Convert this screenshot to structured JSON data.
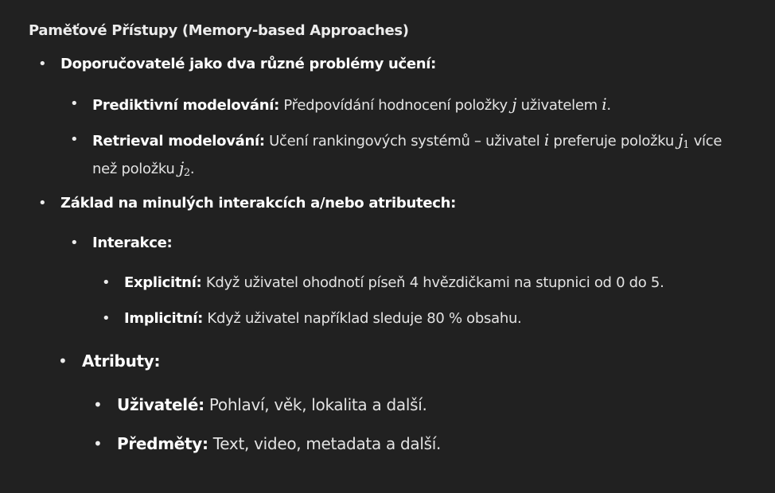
{
  "title": "Paměťové Přístupy (Memory-based Approaches)",
  "sections": {
    "recommenders": {
      "label": "Doporučovatelé jako dva různé problémy učení:",
      "predictive": {
        "label": "Prediktivní modelování:",
        "text_a": " Předpovídání hodnocení položky ",
        "var_j": "j",
        "text_b": " uživatelem ",
        "var_i": "i",
        "text_c": "."
      },
      "retrieval": {
        "label": "Retrieval modelování:",
        "text_a": " Učení rankingových systémů – uživatel ",
        "var_i": "i",
        "text_b": " preferuje položku ",
        "var_j": "j",
        "sub_1": "1",
        "text_c": " více",
        "line2_a": "než položku ",
        "var_j2": "j",
        "sub_2": "2",
        "line2_b": "."
      }
    },
    "basis": {
      "label": "Základ na minulých interakcích a/nebo atributech:",
      "interactions": {
        "label": "Interakce:",
        "explicit": {
          "label": "Explicitní:",
          "text": " Když uživatel ohodnotí píseň 4 hvězdičkami na stupnici od 0 do 5."
        },
        "implicit": {
          "label": "Implicitní:",
          "text": " Když uživatel například sleduje 80 % obsahu."
        }
      },
      "attributes": {
        "label": "Atributy:",
        "users": {
          "label": "Uživatelé:",
          "text": " Pohlaví, věk, lokalita a další."
        },
        "items": {
          "label": "Předměty:",
          "text": " Text, video, metadata a další."
        }
      }
    }
  },
  "colors": {
    "background": "#212121",
    "text": "#ececec"
  }
}
